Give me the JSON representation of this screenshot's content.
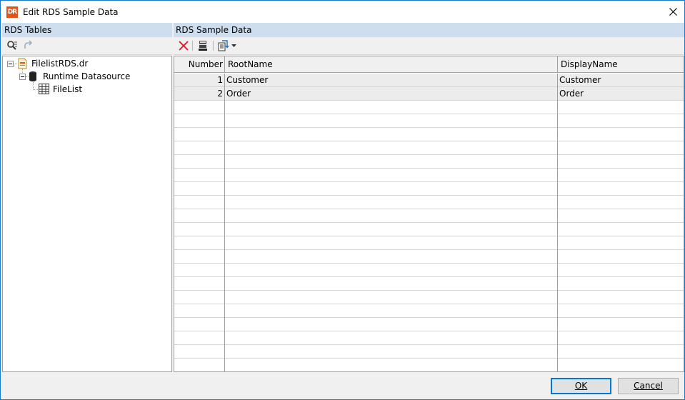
{
  "window": {
    "title": "Edit RDS Sample Data",
    "app_icon_text": "DR"
  },
  "left_panel": {
    "header": "RDS Tables",
    "toolbar": [
      {
        "icon": "find-icon",
        "enabled": true
      },
      {
        "icon": "redo-arrow-icon",
        "enabled": false
      }
    ],
    "tree": [
      {
        "label": "FilelistRDS.dr",
        "icon": "report-file-icon",
        "expanded": true
      },
      {
        "label": "Runtime Datasource",
        "icon": "database-icon",
        "expanded": true
      },
      {
        "label": "FileList",
        "icon": "table-icon",
        "selected": true
      }
    ]
  },
  "right_panel": {
    "header": "RDS Sample Data",
    "toolbar": [
      {
        "icon": "delete-x-icon"
      },
      {
        "icon": "save-data-icon"
      },
      {
        "icon": "import-data-icon",
        "has_dropdown": true
      }
    ],
    "grid": {
      "columns": [
        "Number",
        "RootName",
        "DisplayName"
      ],
      "rows": [
        {
          "number": "1",
          "root_name": "Customer",
          "display_name": "Customer"
        },
        {
          "number": "2",
          "root_name": "Order",
          "display_name": "Order"
        }
      ]
    }
  },
  "footer": {
    "ok_label": "OK",
    "cancel_label": "Cancel"
  },
  "colors": {
    "accent": "#0078d7",
    "header_bg": "#cfdeee",
    "app_icon": "#e2541c",
    "delete_red": "#e81123"
  }
}
